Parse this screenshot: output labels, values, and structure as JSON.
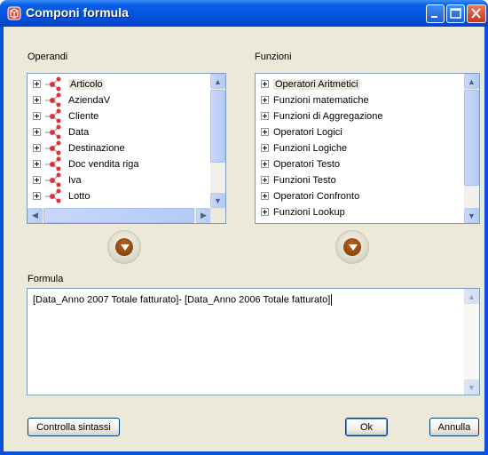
{
  "window": {
    "title": "Componi formula"
  },
  "operandi": {
    "label": "Operandi",
    "items": [
      "Articolo",
      "AziendaV",
      "Cliente",
      "Data",
      "Destinazione",
      "Doc vendita riga",
      "Iva",
      "Lotto"
    ],
    "selected_index": 0
  },
  "funzioni": {
    "label": "Funzioni",
    "items": [
      "Operatori Aritmetici",
      "Funzioni matematiche",
      "Funzioni di Aggregazione",
      "Operatori Logici",
      "Funzioni Logiche",
      "Operatori Testo",
      "Funzioni Testo",
      "Operatori Confronto",
      "Funzioni Lookup"
    ],
    "selected_index": 0
  },
  "formula": {
    "label": "Formula",
    "value": "[Data_Anno 2007 Totale fatturato]- [Data_Anno 2006 Totale fatturato]"
  },
  "buttons": {
    "check_syntax": "Controlla sintassi",
    "ok": "Ok",
    "cancel": "Annulla"
  },
  "colors": {
    "titlebar": "#0453de",
    "client": "#ece9d8",
    "border": "#7f9db9",
    "relation_icon": "#e0303a"
  }
}
